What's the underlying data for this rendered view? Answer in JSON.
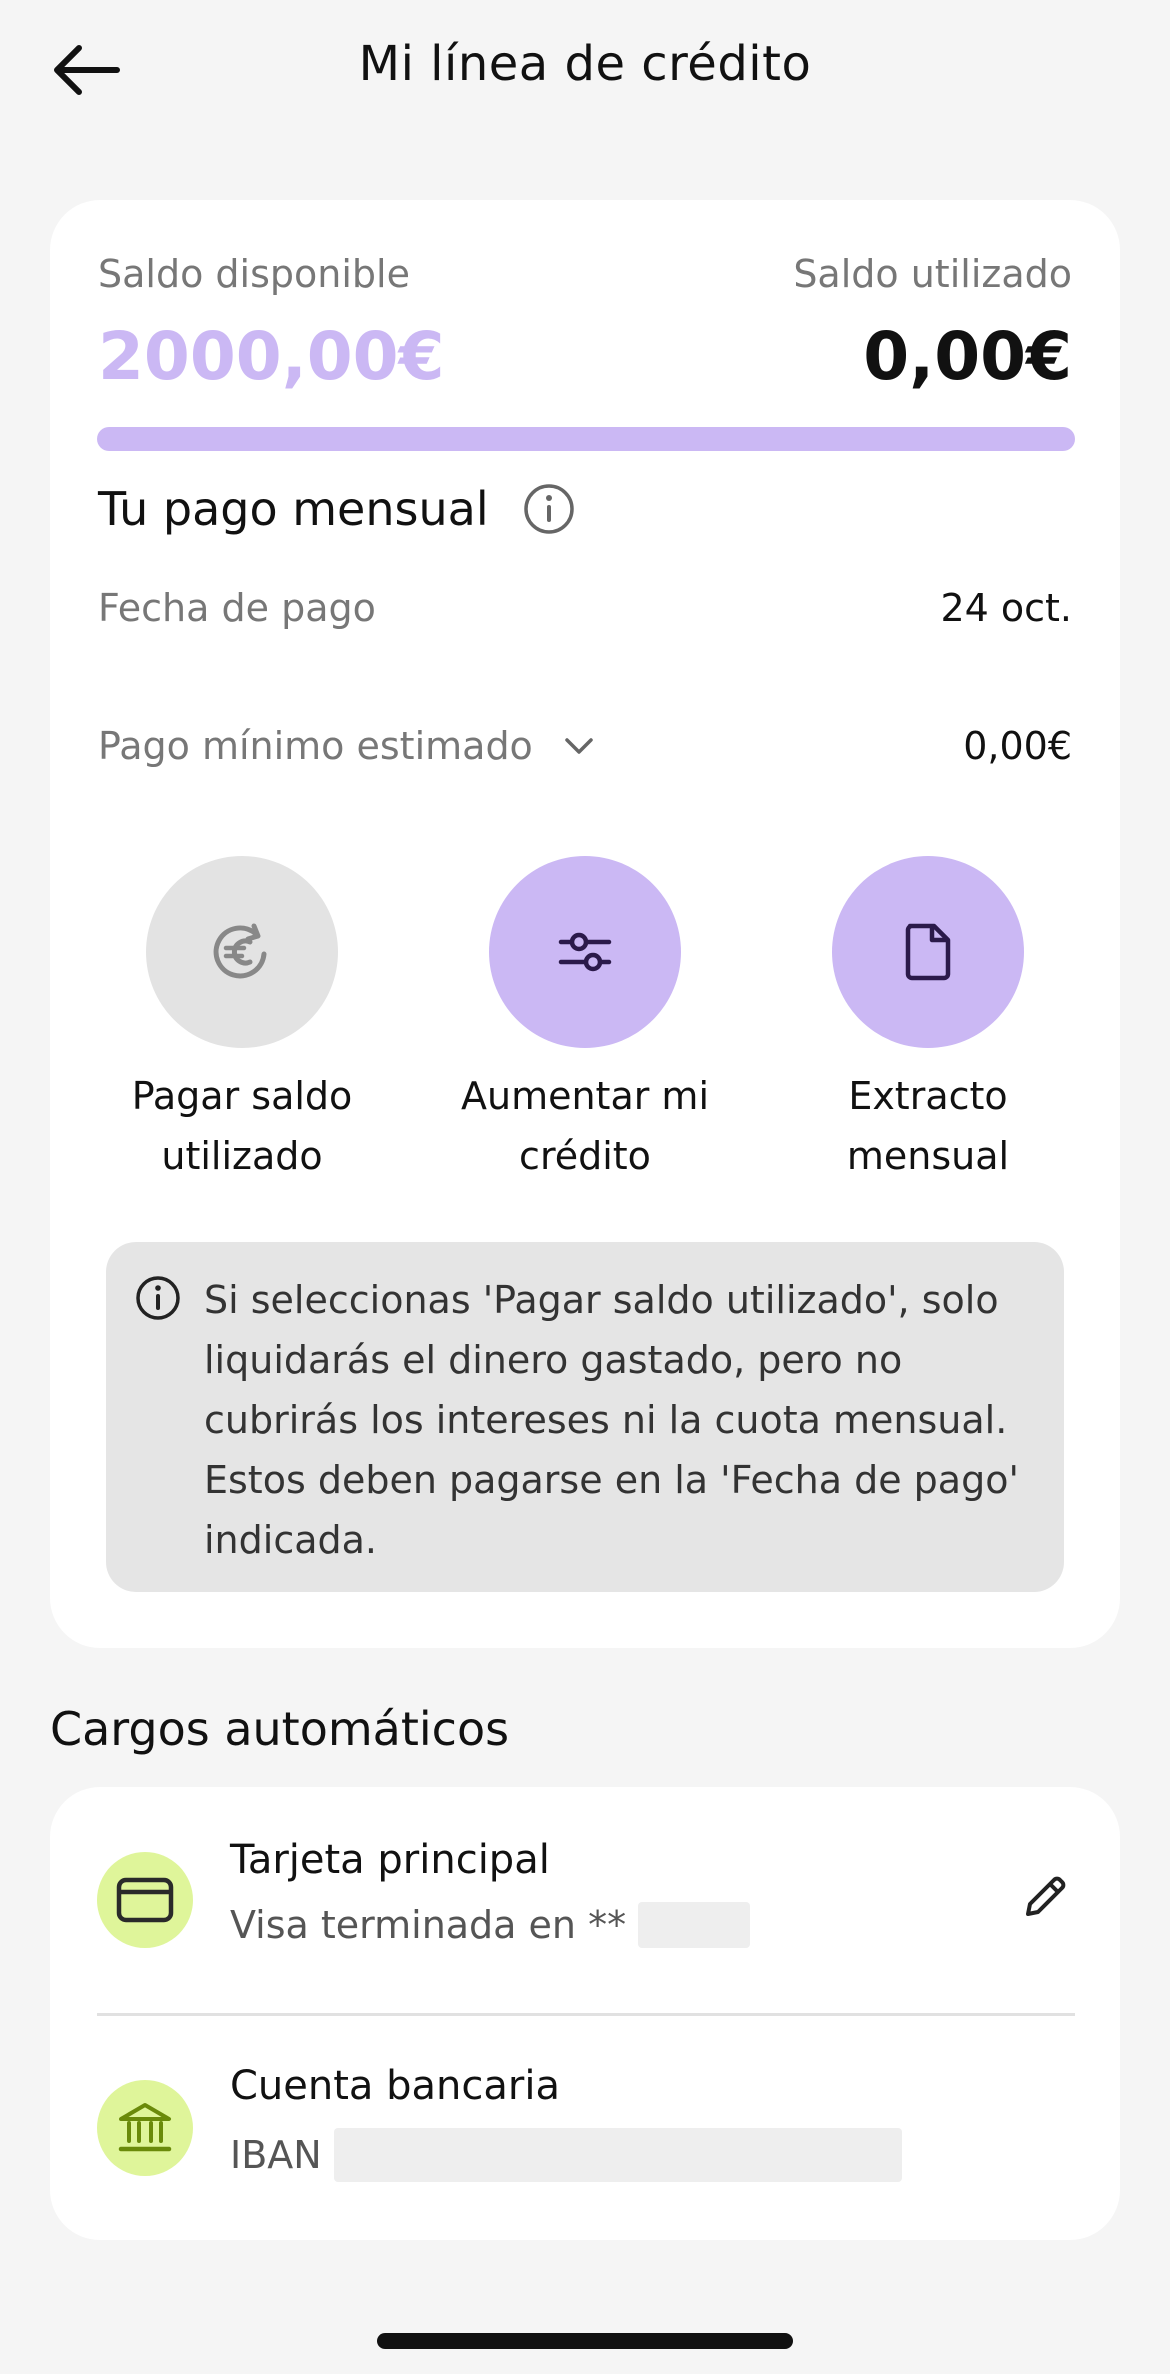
{
  "header": {
    "title": "Mi línea de crédito",
    "back_icon": "arrow-left-icon"
  },
  "balance": {
    "available_label": "Saldo disponible",
    "available_value": "2000,00€",
    "used_label": "Saldo utilizado",
    "used_value": "0,00€",
    "available_fraction": 1.0,
    "accent_color": "#cbb8f4"
  },
  "monthly": {
    "title": "Tu pago mensual",
    "payment_date_label": "Fecha de pago",
    "payment_date_value": "24 oct.",
    "min_payment_label": "Pago mínimo estimado",
    "min_payment_value": "0,00€"
  },
  "actions": [
    {
      "line1": "Pagar saldo",
      "line2": "utilizado",
      "icon": "euro-refresh-icon",
      "enabled": false
    },
    {
      "line1": "Aumentar mi",
      "line2": "crédito",
      "icon": "sliders-icon",
      "enabled": true
    },
    {
      "line1": "Extracto",
      "line2": "mensual",
      "icon": "document-icon",
      "enabled": true
    }
  ],
  "notice": {
    "text": "Si seleccionas 'Pagar saldo utilizado', solo liquidarás el dinero gastado, pero no cubrirás los intereses ni la cuota mensual. Estos deben pagarse en la 'Fecha de pago' indicada."
  },
  "automatic_charges": {
    "title": "Cargos automáticos",
    "items": [
      {
        "title": "Tarjeta principal",
        "subtitle": "Visa terminada en **",
        "icon": "credit-card-icon"
      },
      {
        "title": "Cuenta bancaria",
        "subtitle": "IBAN",
        "icon": "bank-icon"
      }
    ],
    "badge_color": "#dff59a"
  }
}
